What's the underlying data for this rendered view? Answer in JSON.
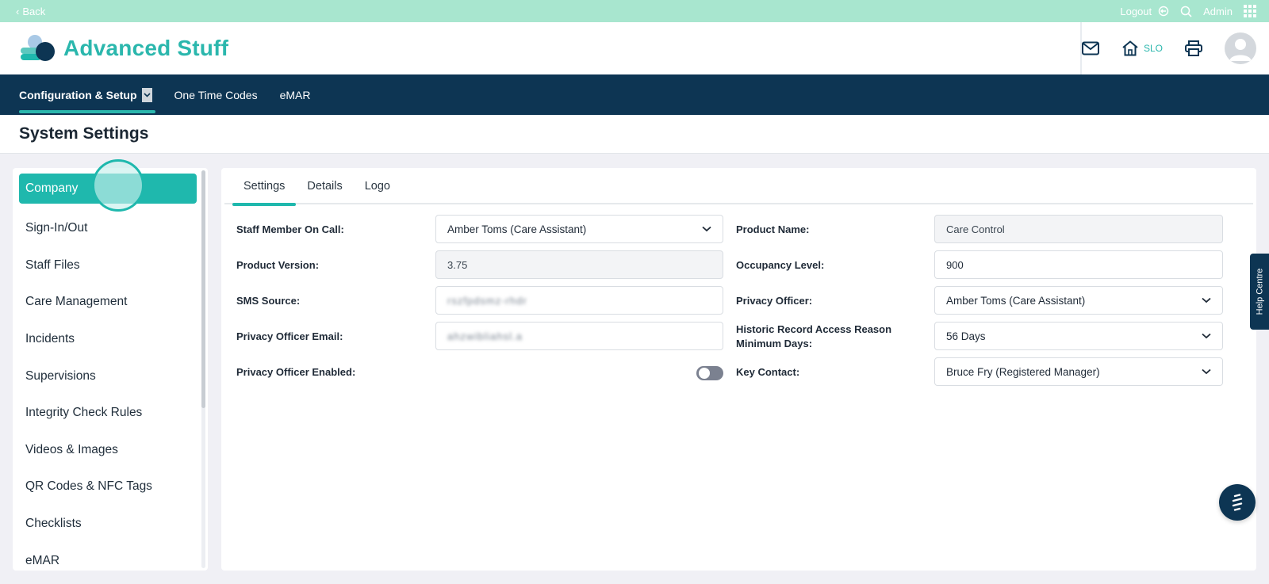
{
  "topbar": {
    "back_label": "Back",
    "logout_label": "Logout",
    "admin_label": "Admin"
  },
  "header": {
    "brand_title": "Advanced Stuff",
    "home_label": "SLO"
  },
  "nav": {
    "items": [
      {
        "label": "Configuration & Setup"
      },
      {
        "label": "One Time Codes"
      },
      {
        "label": "eMAR"
      }
    ]
  },
  "page": {
    "title": "System Settings"
  },
  "sidebar": {
    "items": [
      {
        "label": "Company"
      },
      {
        "label": "Sign-In/Out"
      },
      {
        "label": "Staff Files"
      },
      {
        "label": "Care Management"
      },
      {
        "label": "Incidents"
      },
      {
        "label": "Supervisions"
      },
      {
        "label": "Integrity Check Rules"
      },
      {
        "label": "Videos & Images"
      },
      {
        "label": "QR Codes & NFC Tags"
      },
      {
        "label": "Checklists"
      },
      {
        "label": "eMAR"
      }
    ]
  },
  "tabs": [
    {
      "label": "Settings"
    },
    {
      "label": "Details"
    },
    {
      "label": "Logo"
    }
  ],
  "form": {
    "staff_on_call": {
      "label": "Staff Member On Call:",
      "value": "Amber Toms (Care Assistant)"
    },
    "product_version": {
      "label": "Product Version:",
      "value": "3.75"
    },
    "sms_source": {
      "label": "SMS Source:",
      "value": "rszfpdsmz-rhdr"
    },
    "privacy_email": {
      "label": "Privacy Officer Email:",
      "value": "ahzwibliahsl.a"
    },
    "privacy_enabled": {
      "label": "Privacy Officer Enabled:"
    },
    "product_name": {
      "label": "Product Name:",
      "value": "Care Control"
    },
    "occupancy": {
      "label": "Occupancy Level:",
      "value": "900"
    },
    "privacy_officer": {
      "label": "Privacy Officer:",
      "value": "Amber Toms (Care Assistant)"
    },
    "historic_access": {
      "label_line1": "Historic Record Access Reason",
      "label_line2": "Minimum Days:",
      "value": "56 Days"
    },
    "key_contact": {
      "label": "Key Contact:",
      "value": "Bruce Fry (Registered Manager)"
    }
  },
  "widgets": {
    "help_centre_label": "Help Centre"
  },
  "colors": {
    "accent": "#1fb8ad",
    "navy": "#0d3553",
    "topbar": "#a8e6cf"
  }
}
